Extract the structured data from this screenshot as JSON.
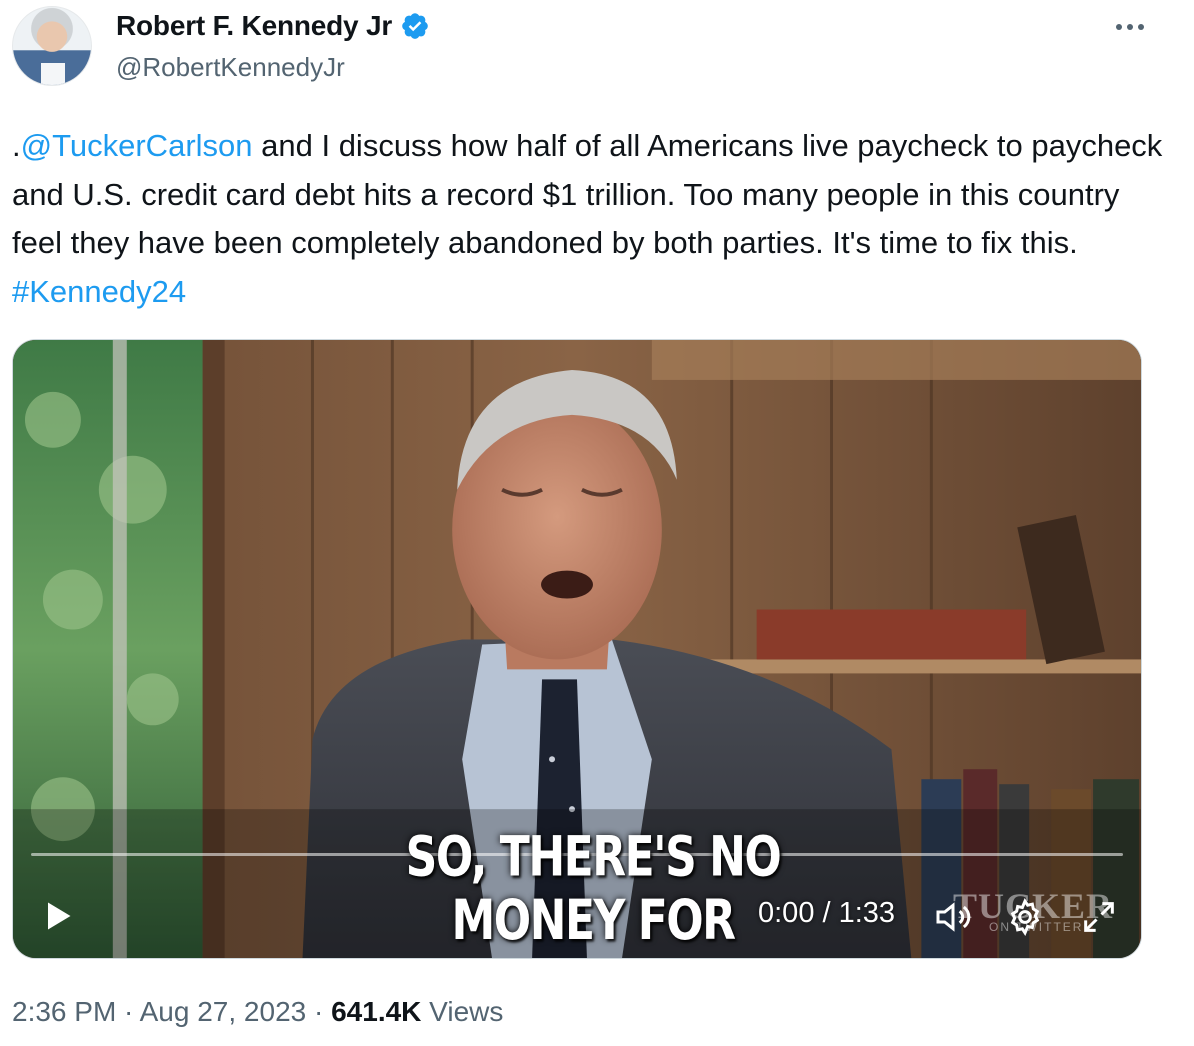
{
  "author": {
    "display_name": "Robert F. Kennedy Jr",
    "handle": "@RobertKennedyJr",
    "verified": true,
    "avatar_icon": "profile-photo"
  },
  "more_icon": "more-horizontal-icon",
  "text": {
    "prefix": ".",
    "mention": "@TuckerCarlson",
    "body": " and I discuss how half of all Americans live paycheck to paycheck and U.S. credit card debt hits a record $1 trillion. Too many people in this country feel they have been completely abandoned by both parties. It's time to fix this. ",
    "hashtag": "#Kennedy24"
  },
  "video": {
    "caption": "SO, THERE'S NO MONEY FOR",
    "timecode": "0:00 / 1:33",
    "watermark": "TUCKER",
    "watermark_sub": "ON TWITTER",
    "progress": 0.0,
    "icons": [
      "play-icon",
      "volume-icon",
      "settings-icon",
      "fullscreen-icon"
    ]
  },
  "meta": {
    "time": "2:36 PM",
    "separator": " · ",
    "date": "Aug 27, 2023",
    "views_count": "641.4K",
    "views_label": " Views"
  },
  "colors": {
    "link": "#1d9bf0",
    "secondary_text": "#536471",
    "primary_text": "#0f1419"
  }
}
